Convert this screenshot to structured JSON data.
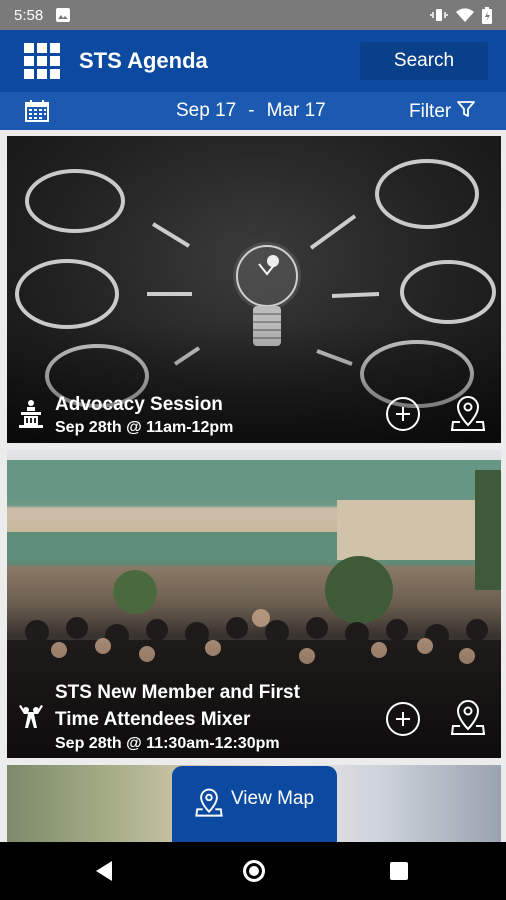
{
  "status_bar": {
    "time": "5:58"
  },
  "header": {
    "title": "STS Agenda",
    "search_label": "Search"
  },
  "date_bar": {
    "start": "Sep 17",
    "separator": "-",
    "end": "Mar 17",
    "filter_label": "Filter"
  },
  "events": [
    {
      "title": "Advocacy Session",
      "title_line2": "",
      "time": "Sep 28th @ 11am-12pm",
      "type_icon": "podium-icon"
    },
    {
      "title": "STS New Member and First",
      "title_line2": "Time Attendees Mixer",
      "time": "Sep 28th @ 11:30am-12:30pm",
      "type_icon": "celebration-icon"
    }
  ],
  "view_map": {
    "label": "View Map"
  },
  "colors": {
    "primary": "#0b4aa0",
    "primary_dark": "#0a3f8a",
    "date_bar": "#1b5ab0"
  }
}
